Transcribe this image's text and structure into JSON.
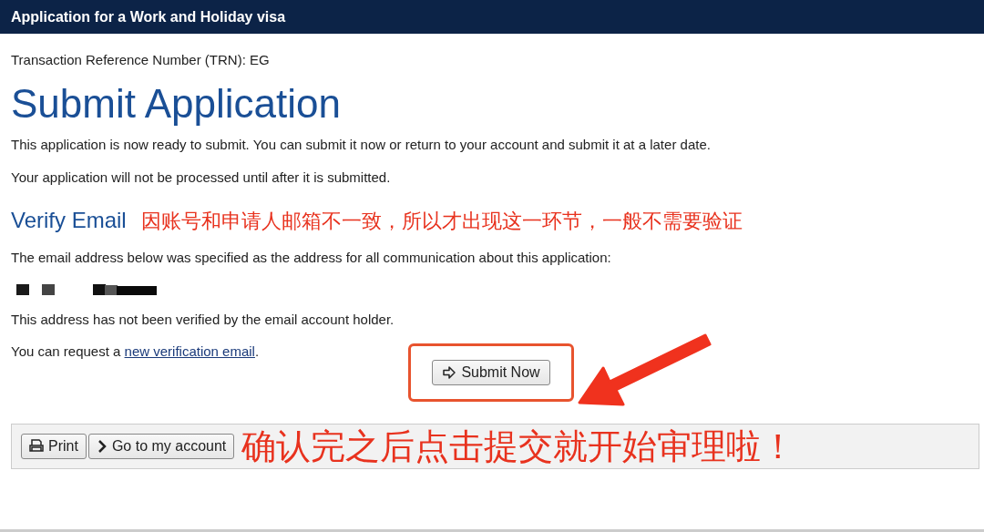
{
  "header": {
    "title": "Application for a Work and Holiday visa"
  },
  "trn": "Transaction Reference Number (TRN): EG",
  "heading": "Submit Application",
  "intro": [
    "This application is now ready to submit. You can submit it now or return to your account and submit it at a later date.",
    "Your application will not be processed until after it is submitted."
  ],
  "verify": {
    "heading": "Verify Email",
    "annotation": "因账号和申请人邮箱不一致，所以才出现这一环节，一般不需要验证",
    "description": "The email address below was specified as the address for all communication about this application:",
    "status": "This address has not been verified by the email account holder.",
    "request_text": "You can request a ",
    "request_link": "new verification email",
    "request_end": "."
  },
  "submit_button": {
    "label": "Submit Now"
  },
  "footer": {
    "buttons": [
      {
        "label": "Print",
        "kind": "print"
      },
      {
        "label": "Go to my account",
        "kind": "next"
      }
    ],
    "annotation": "确认完之后点击提交就开始审理啦！"
  }
}
